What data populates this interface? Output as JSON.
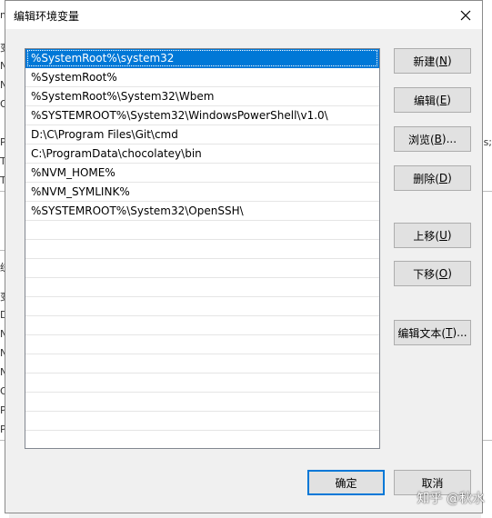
{
  "dialog": {
    "title": "编辑环境变量",
    "close_icon": "close-icon"
  },
  "paths": [
    "%SystemRoot%\\system32",
    "%SystemRoot%",
    "%SystemRoot%\\System32\\Wbem",
    "%SYSTEMROOT%\\System32\\WindowsPowerShell\\v1.0\\",
    "D:\\C\\Program Files\\Git\\cmd",
    "C:\\ProgramData\\chocolatey\\bin",
    "%NVM_HOME%",
    "%NVM_SYMLINK%",
    "%SYSTEMROOT%\\System32\\OpenSSH\\",
    "",
    "",
    "",
    "",
    "",
    "",
    "",
    "",
    "",
    "",
    "",
    ""
  ],
  "selected_index": 0,
  "buttons": {
    "new": {
      "text": "新建(",
      "key": "N",
      "end": ")"
    },
    "edit": {
      "text": "编辑(",
      "key": "E",
      "end": ")"
    },
    "browse": {
      "text": "浏览(",
      "key": "B",
      "end": ")..."
    },
    "delete": {
      "text": "删除(",
      "key": "D",
      "end": ")"
    },
    "up": {
      "text": "上移(",
      "key": "U",
      "end": ")"
    },
    "down": {
      "text": "下移(",
      "key": "O",
      "end": ")"
    },
    "edit_text": {
      "text": "编辑文本(",
      "key": "T",
      "end": ")..."
    },
    "ok": "确定",
    "cancel": "取消"
  },
  "watermark": "知乎 @秋水",
  "background": {
    "left_fragments": [
      "m",
      "变",
      "N",
      "N",
      "O",
      "Pa",
      "TE",
      "TI",
      "统",
      "变",
      "D",
      "N",
      "N",
      "N",
      "O",
      "Pa",
      "PA"
    ],
    "right_fragments": [
      "s;"
    ]
  },
  "colors": {
    "selection": "#0078d7",
    "default_button_border": "#0078d7"
  }
}
